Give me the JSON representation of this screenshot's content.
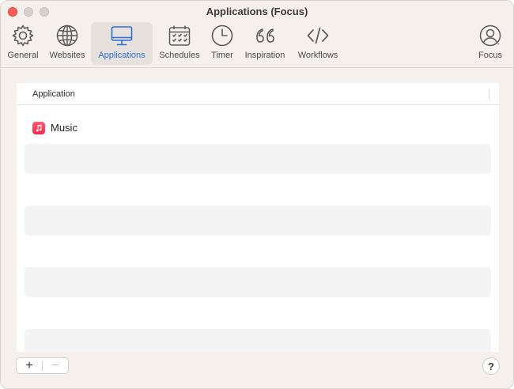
{
  "window": {
    "title": "Applications (Focus)"
  },
  "toolbar": {
    "items": [
      {
        "label": "General",
        "icon": "gear-icon"
      },
      {
        "label": "Websites",
        "icon": "globe-icon"
      },
      {
        "label": "Applications",
        "icon": "monitor-icon",
        "active": true
      },
      {
        "label": "Schedules",
        "icon": "calendar-icon"
      },
      {
        "label": "Timer",
        "icon": "clock-icon"
      },
      {
        "label": "Inspiration",
        "icon": "quote-icon"
      },
      {
        "label": "Workflows",
        "icon": "code-icon"
      }
    ],
    "account": {
      "label": "Focus",
      "icon": "person-circle-icon"
    }
  },
  "table": {
    "column_header": "Application",
    "rows": [
      {
        "name": "Music",
        "icon": "music-app-icon"
      }
    ]
  },
  "footer": {
    "add_label": "+",
    "remove_label": "−",
    "help_label": "?"
  },
  "colors": {
    "accent": "#2d6fd6",
    "window_bg": "#f5f0ec",
    "close": "#ff5f57"
  }
}
